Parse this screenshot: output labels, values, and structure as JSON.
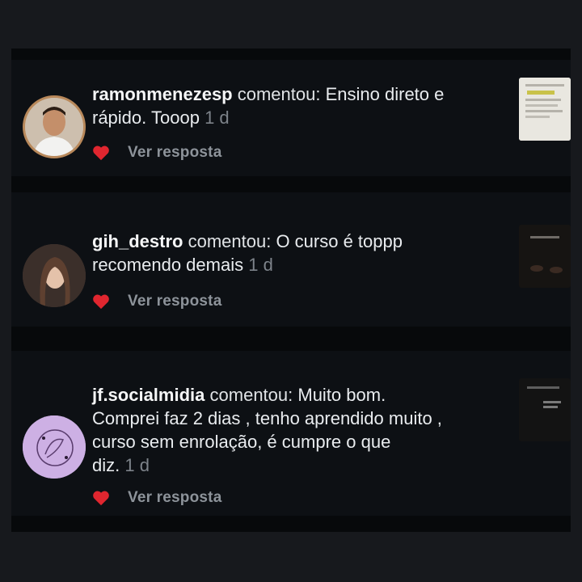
{
  "comments": [
    {
      "username": "ramonmenezesp",
      "verb": "comentou:",
      "text_lines": [
        "Ensino direto e",
        "rápido. Tooop"
      ],
      "time": "1 d",
      "reply_label": "Ver resposta",
      "heart_color": "#e0262f"
    },
    {
      "username": "gih_destro",
      "verb": "comentou:",
      "text_lines": [
        "O curso é toppp",
        "recomendo demais"
      ],
      "time": "1 d",
      "reply_label": "Ver resposta",
      "heart_color": "#e0262f"
    },
    {
      "username": "jf.socialmidia",
      "verb": "comentou:",
      "text_lines": [
        "Muito bom.",
        "Comprei faz 2 dias , tenho aprendido muito ,",
        "curso sem enrolação, é cumpre o que",
        "diz."
      ],
      "time": "1 d",
      "reply_label": "Ver resposta",
      "heart_color": "#e0262f"
    }
  ]
}
